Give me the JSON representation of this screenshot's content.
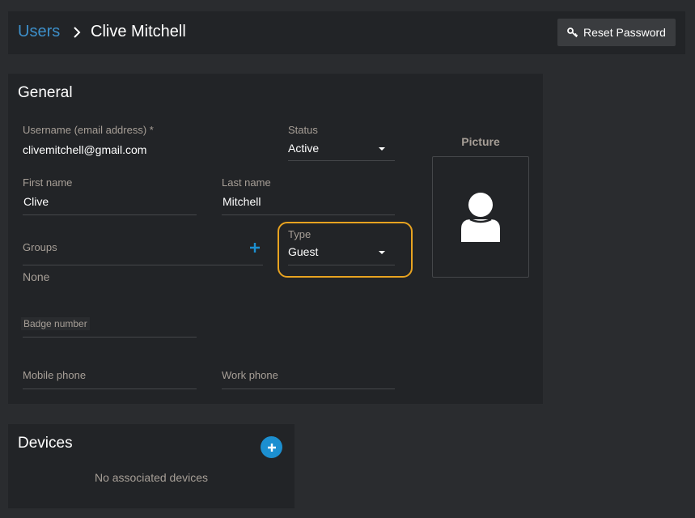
{
  "breadcrumb": {
    "parent": "Users",
    "current": "Clive Mitchell"
  },
  "header": {
    "reset_password_label": "Reset Password",
    "reset_icon": "key-icon"
  },
  "general": {
    "title": "General",
    "username": {
      "label": "Username (email address) *",
      "value": "clivemitchell@gmail.com"
    },
    "status": {
      "label": "Status",
      "value": "Active"
    },
    "first_name": {
      "label": "First name",
      "value": "Clive"
    },
    "last_name": {
      "label": "Last name",
      "value": "Mitchell"
    },
    "groups": {
      "label": "Groups",
      "value": "None"
    },
    "type": {
      "label": "Type",
      "value": "Guest"
    },
    "badge_number": {
      "label": "Badge number",
      "value": ""
    },
    "mobile_phone": {
      "label": "Mobile phone",
      "value": ""
    },
    "work_phone": {
      "label": "Work phone",
      "value": ""
    },
    "picture": {
      "label": "Picture",
      "icon": "user-silhouette-icon"
    }
  },
  "devices": {
    "title": "Devices",
    "empty_text": "No associated devices"
  },
  "colors": {
    "background": "#2a2c2f",
    "card": "#222427",
    "accent": "#1c8fd0",
    "link": "#3d8fc9",
    "highlight": "#e8a320",
    "label": "#a79f97"
  }
}
